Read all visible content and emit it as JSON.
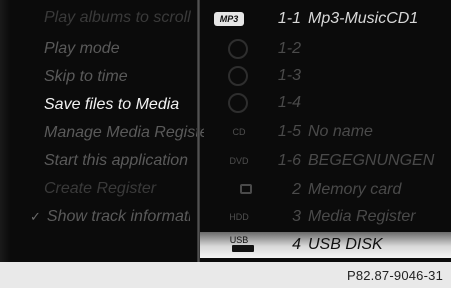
{
  "menu": {
    "items": [
      {
        "label": "Play albums to scroll",
        "state": "dim"
      },
      {
        "label": "Play mode",
        "state": "dim"
      },
      {
        "label": "Skip to time",
        "state": "dim"
      },
      {
        "label": "Save files to Media",
        "state": "active"
      },
      {
        "label": "Manage Media Register",
        "state": "dim"
      },
      {
        "label": "Start this application",
        "state": "dim"
      },
      {
        "label": "Create Register",
        "state": "dimmer"
      }
    ],
    "check_item": {
      "label": "Show track information",
      "check": "✓"
    }
  },
  "sources": [
    {
      "icon": "MP3",
      "num": "1-1",
      "name": "Mp3-MusicCD1",
      "state": "top"
    },
    {
      "icon": "disc-icon",
      "num": "1-2",
      "name": "",
      "state": "dim"
    },
    {
      "icon": "disc-icon",
      "num": "1-3",
      "name": "",
      "state": "dim"
    },
    {
      "icon": "disc-icon",
      "num": "1-4",
      "name": "",
      "state": "dim"
    },
    {
      "icon": "CD",
      "num": "1-5",
      "name": "No name",
      "state": "dim"
    },
    {
      "icon": "DVD",
      "num": "1-6",
      "name": "BEGEGNUNGEN",
      "state": "dim"
    },
    {
      "icon": "card-icon",
      "num": "2",
      "name": "Memory card",
      "state": "dim"
    },
    {
      "icon": "HDD",
      "num": "3",
      "name": "Media Register",
      "state": "dim"
    },
    {
      "icon": "USB",
      "num": "4",
      "name": "USB DISK",
      "state": "selected"
    }
  ],
  "footer": {
    "reference": "P82.87-9046-31"
  }
}
